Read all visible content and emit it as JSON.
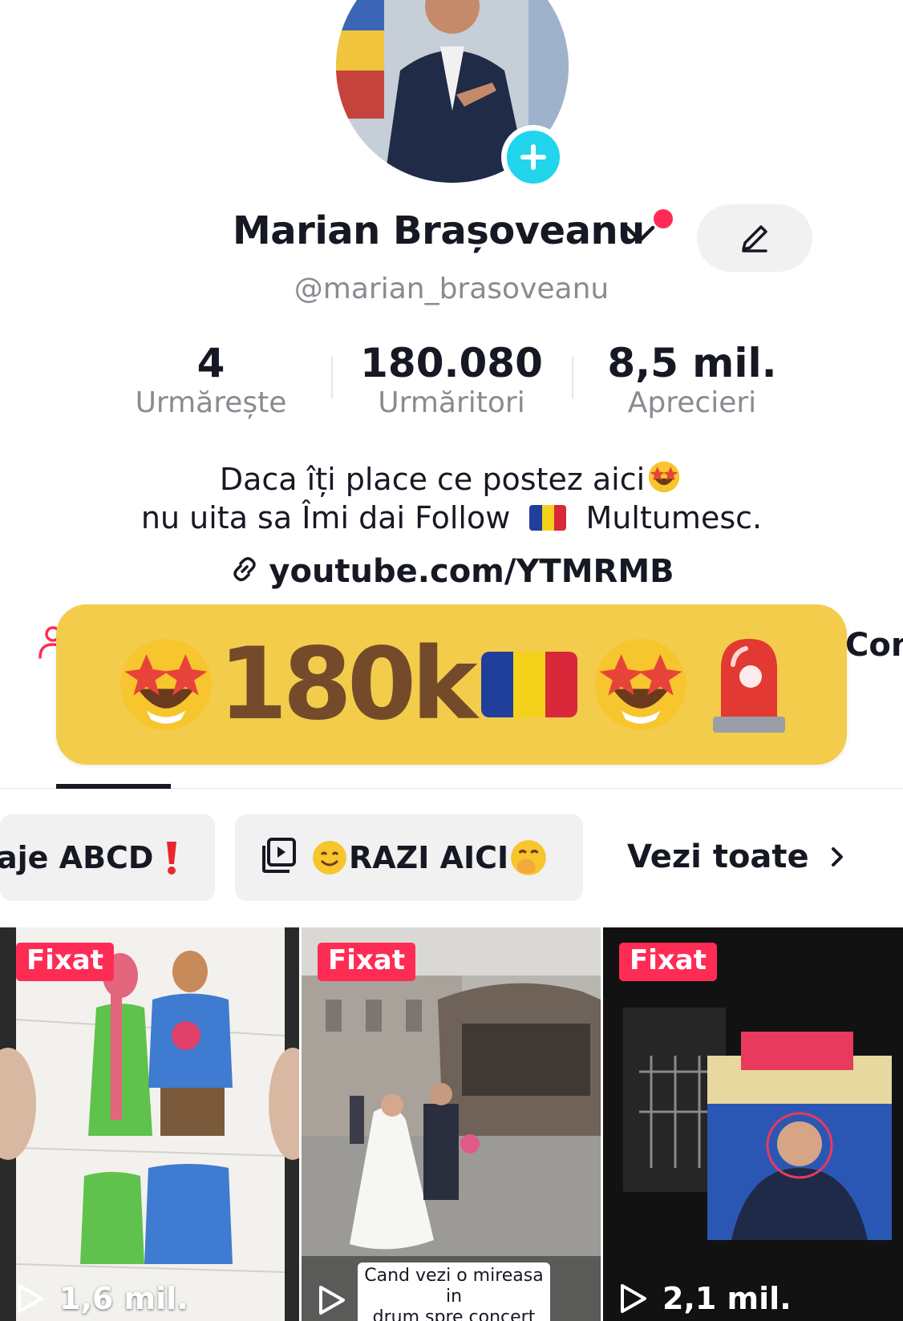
{
  "profile": {
    "name": "Marian Brașoveanu",
    "handle": "@marian_brasoveanu"
  },
  "stats": [
    {
      "value": "4",
      "label": "Urmărește"
    },
    {
      "value": "180.080",
      "label": "Urmăritori"
    },
    {
      "value": "8,5 mil.",
      "label": "Aprecieri"
    }
  ],
  "bio": {
    "line1": "Daca îți place ce postez aici",
    "line2a": "nu uita sa Îmi dai Follow",
    "line2b": "Multumesc.",
    "link": "youtube.com/YTMRMB"
  },
  "banner": {
    "text": "180k"
  },
  "side_tab_partial": "Con",
  "playlists": {
    "chip1": "aje ABCD",
    "chip2": "RAZI AICI",
    "see_all": "Vezi toate"
  },
  "videos": [
    {
      "badge": "Fixat",
      "views": "1,6 mil."
    },
    {
      "badge": "Fixat",
      "views": "",
      "caption_line1": "Cand vezi o mireasa in",
      "caption_line2": "drum spre concert"
    },
    {
      "badge": "Fixat",
      "views": "2,1 mil."
    }
  ],
  "colors": {
    "accent": "#fe2c55",
    "follow_blue": "#20d5ec",
    "banner_yellow": "#f3cc4b",
    "text": "#161823",
    "muted": "#8a8b91"
  },
  "icons": [
    "plus-icon",
    "chevron-down-icon",
    "pencil-icon",
    "link-icon",
    "person-icon",
    "playlist-icon",
    "chevron-right-icon",
    "play-icon"
  ]
}
